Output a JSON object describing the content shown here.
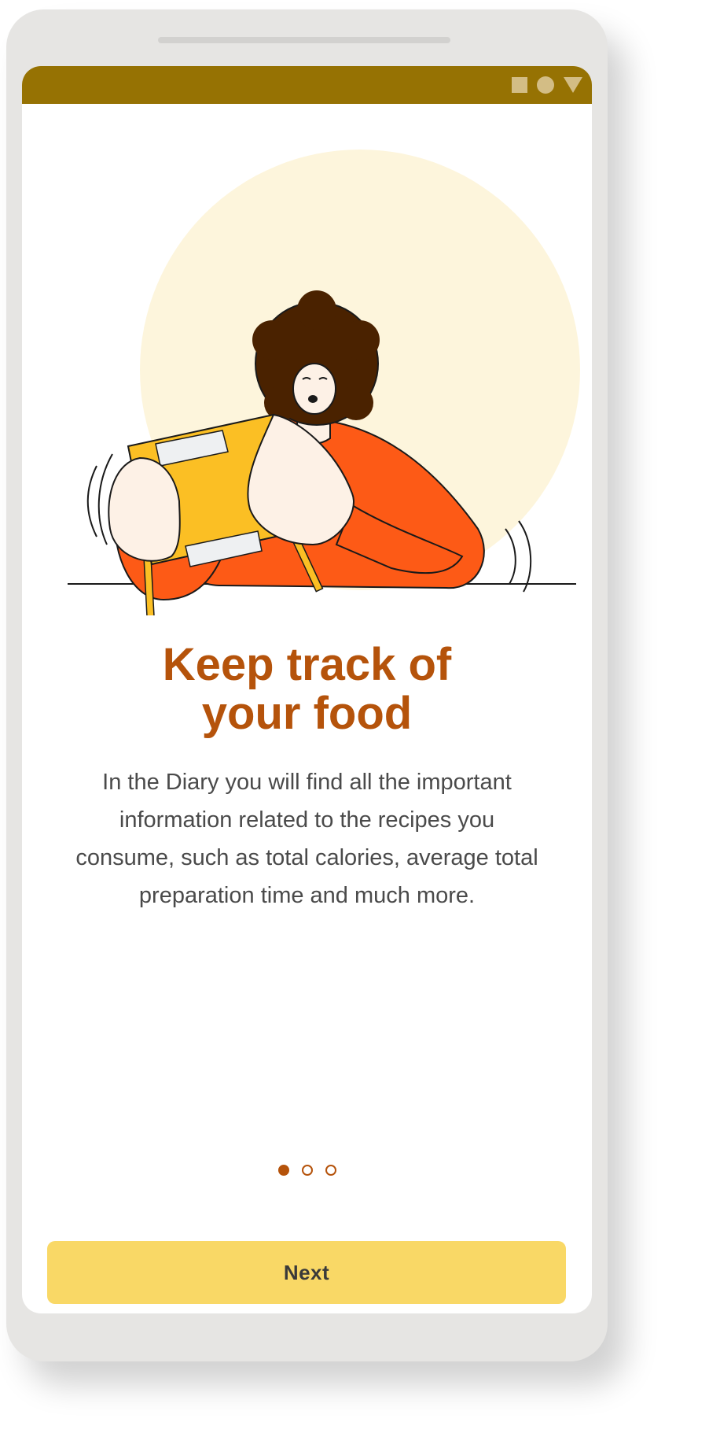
{
  "onboarding": {
    "title_line1": "Keep track of",
    "title_line2": "your food",
    "description": "In the Diary you will find all the important information related to the recipes you consume, such as total calories, average total preparation time and much more.",
    "pager": {
      "total": 3,
      "current": 1
    },
    "next_label": "Next"
  },
  "statusbar": {
    "icons": [
      "square-icon",
      "circle-icon",
      "triangle-icon"
    ]
  },
  "colors": {
    "status_bar": "#967203",
    "title": "#b5530b",
    "button": "#f9d866",
    "illustration_circle": "#fdf5dc",
    "shirt": "#fd5a16",
    "notebook": "#fbbf24"
  },
  "illustration": {
    "name": "person-reading-notebook-illustration"
  }
}
